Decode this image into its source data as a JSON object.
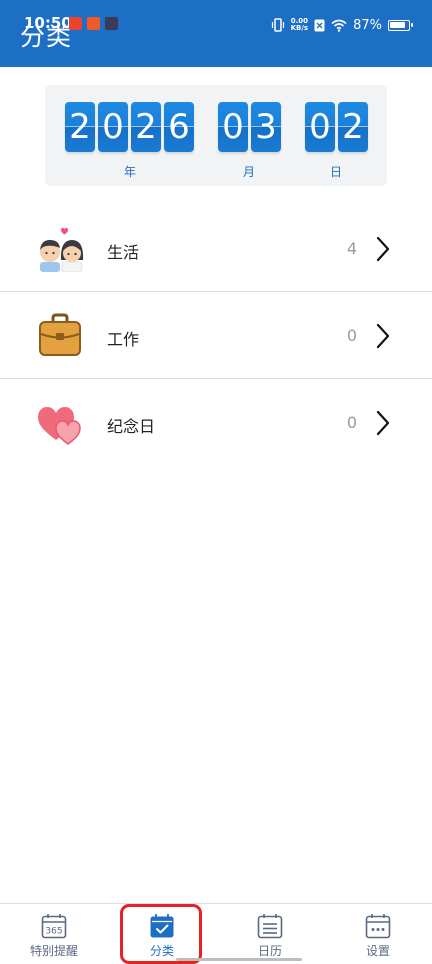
{
  "status_bar": {
    "time": "10:50",
    "network_speed_value": "0.00",
    "network_speed_unit": "KB/s",
    "battery": "87%",
    "battery_level": 0.87
  },
  "header": {
    "title": "分类"
  },
  "date_counter": {
    "year_digits": [
      "2",
      "0",
      "2",
      "6"
    ],
    "month_digits": [
      "0",
      "3"
    ],
    "day_digits": [
      "0",
      "2"
    ],
    "year_label": "年",
    "month_label": "月",
    "day_label": "日"
  },
  "categories": [
    {
      "name": "生活",
      "count": "4",
      "icon": "couple-icon"
    },
    {
      "name": "工作",
      "count": "0",
      "icon": "briefcase-icon"
    },
    {
      "name": "纪念日",
      "count": "0",
      "icon": "hearts-icon"
    }
  ],
  "bottom_nav": [
    {
      "label": "特别提醒",
      "icon": "calendar-365-icon",
      "icon_text": "365",
      "active": false
    },
    {
      "label": "分类",
      "icon": "calendar-check-icon",
      "active": true
    },
    {
      "label": "日历",
      "icon": "calendar-list-icon",
      "active": false
    },
    {
      "label": "设置",
      "icon": "calendar-dots-icon",
      "active": false
    }
  ],
  "colors": {
    "primary": "#1d6fc5",
    "digit_tile": "#1a7fd7",
    "highlight": "#e52323",
    "nav_inactive": "#5a6a80"
  }
}
